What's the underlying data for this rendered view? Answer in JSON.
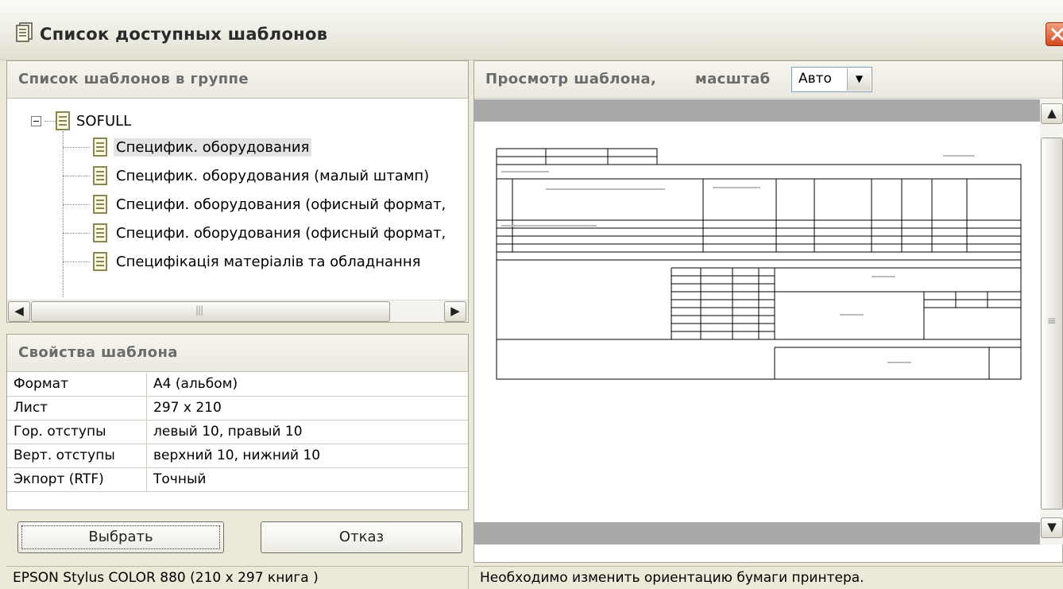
{
  "window": {
    "title": "Список доступных шаблонов",
    "close_label": "✕"
  },
  "left": {
    "group_header": "Список шаблонов в группе",
    "tree": {
      "root": "SOFULL",
      "items": [
        {
          "label": "Специфик. оборудования",
          "selected": true
        },
        {
          "label": "Специфик. оборудования (малый штамп)",
          "selected": false
        },
        {
          "label": "Специфи. оборудования (офисный формат,",
          "selected": false
        },
        {
          "label": "Специфи. оборудования (офисный формат,",
          "selected": false
        },
        {
          "label": "Специфікація матеріалів та обладнання",
          "selected": false
        }
      ]
    },
    "props_header": "Свойства шаблона",
    "props": [
      {
        "key": "Формат",
        "value": "А4 (альбом)"
      },
      {
        "key": "Лист",
        "value": "297 x 210"
      },
      {
        "key": "Гор. отступы",
        "value": "левый 10,  правый 10"
      },
      {
        "key": "Верт. отступы",
        "value": "верхний 10,  нижний 10"
      },
      {
        "key": "Экпорт (RTF)",
        "value": "Точный"
      }
    ],
    "select_button": "Выбрать",
    "cancel_button": "Отказ",
    "status": "EPSON Stylus COLOR 880 (210 x 297 книга )"
  },
  "right": {
    "preview_header": "Просмотр шаблона,",
    "scale_label": "масштаб",
    "scale_value": "Авто",
    "status": "Необходимо изменить ориентацию бумаги принтера."
  },
  "colors": {
    "titlebar": "#eeede4",
    "close_button": "#d04a20",
    "panel_header_text": "#6b6b6b",
    "preview_gray": "#a9a9a9"
  }
}
